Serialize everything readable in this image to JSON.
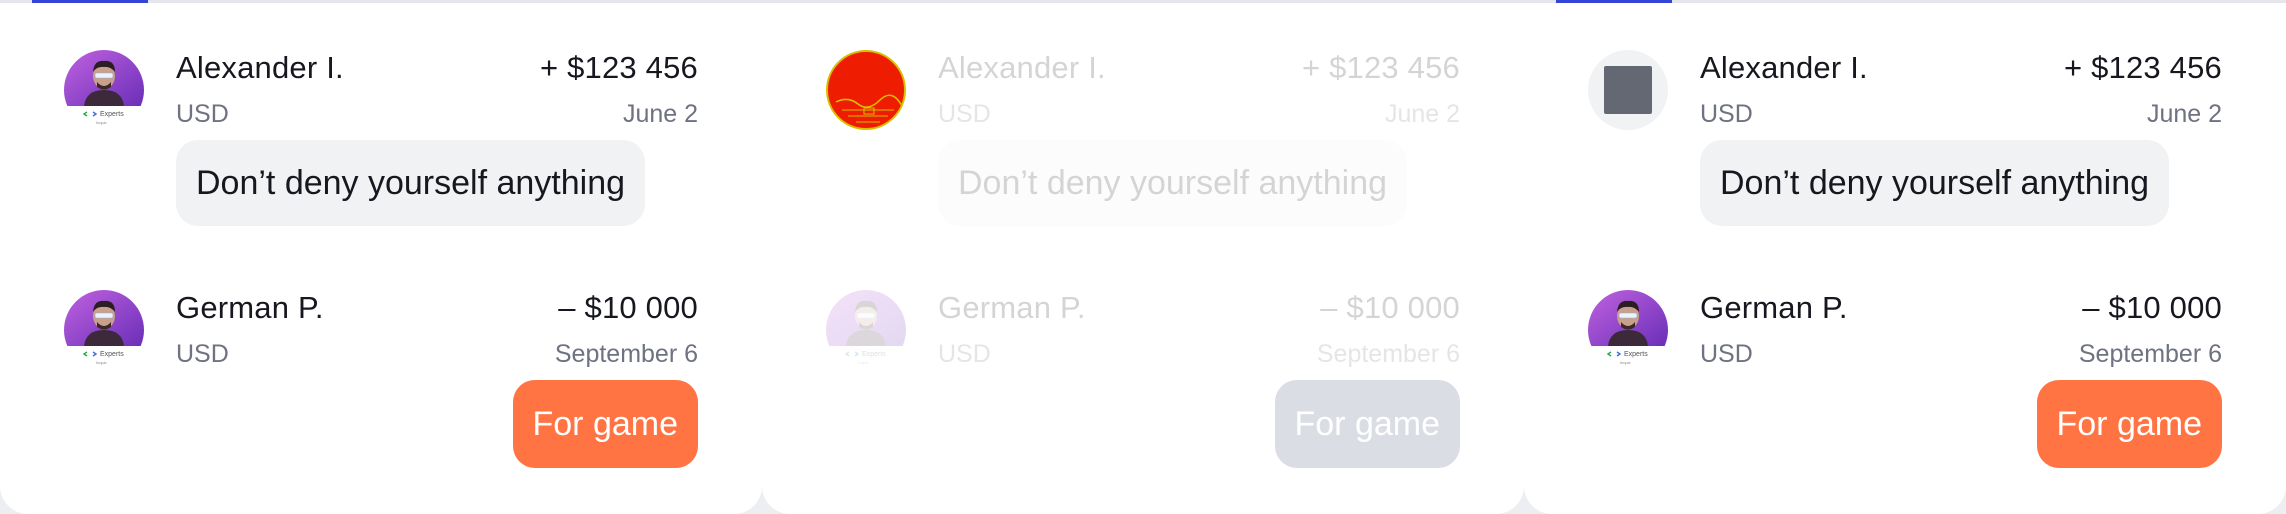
{
  "colors": {
    "accent": "#3545d8",
    "tag_background": "#ff7442",
    "placeholder_icon": "#636873",
    "broken_avatar": "#ee1c00"
  },
  "avatar": {
    "badge_text": "Experts",
    "badge_subtext": "Inquix"
  },
  "cards": [
    {
      "state": "normal",
      "transactions": [
        {
          "avatar": "photo",
          "name": "Alexander I.",
          "amount": "+ $123 456",
          "currency": "USD",
          "date": "June 2",
          "note": "Don’t deny yourself anything",
          "note_style": "bubble"
        },
        {
          "avatar": "photo",
          "name": "German P.",
          "amount": "– $10 000",
          "currency": "USD",
          "date": "September 6",
          "note": "For game",
          "note_style": "tag"
        }
      ]
    },
    {
      "state": "loading-faded",
      "transactions": [
        {
          "avatar": "broken-image",
          "name": "Alexander I.",
          "amount": "+ $123 456",
          "currency": "USD",
          "date": "June 2",
          "note": "Don’t deny yourself anything",
          "note_style": "bubble"
        },
        {
          "avatar": "photo",
          "name": "German P.",
          "amount": "– $10 000",
          "currency": "USD",
          "date": "September 6",
          "note": "For game",
          "note_style": "tag"
        }
      ]
    },
    {
      "state": "normal",
      "transactions": [
        {
          "avatar": "image-placeholder",
          "name": "Alexander I.",
          "amount": "+ $123 456",
          "currency": "USD",
          "date": "June 2",
          "note": "Don’t deny yourself anything",
          "note_style": "bubble"
        },
        {
          "avatar": "photo",
          "name": "German P.",
          "amount": "– $10 000",
          "currency": "USD",
          "date": "September 6",
          "note": "For game",
          "note_style": "tag"
        }
      ]
    }
  ]
}
